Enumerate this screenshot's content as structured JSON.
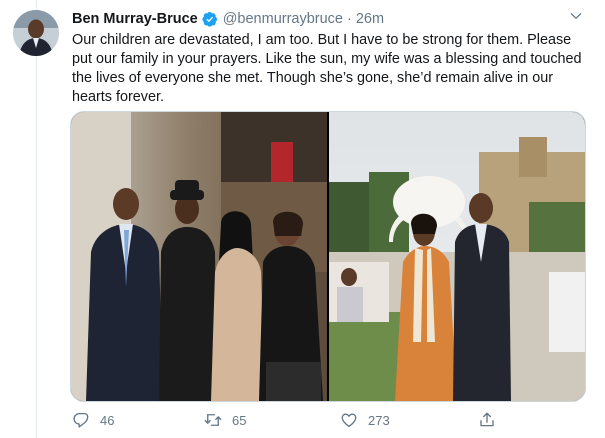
{
  "tweet": {
    "author_name": "Ben Murray-Bruce",
    "verified_icon": "verified-badge-icon",
    "handle": "@benmurraybruce",
    "separator": "·",
    "time": "26m",
    "text": "Our children are devastated, I am too. But I have to be strong for them. Please put our family in your prayers. Like the sun, my wife was a blessing and touched the lives of everyone she met. Though she’s gone, she’d remain alive in our hearts forever."
  },
  "media": {
    "count": 2,
    "photos": [
      "family-photo",
      "couple-photo"
    ]
  },
  "actions": {
    "replies": "46",
    "retweets": "65",
    "likes": "273"
  },
  "colors": {
    "text": "#14171a",
    "secondary": "#657786",
    "verified": "#1da1f2",
    "border": "#ccd6dd"
  }
}
